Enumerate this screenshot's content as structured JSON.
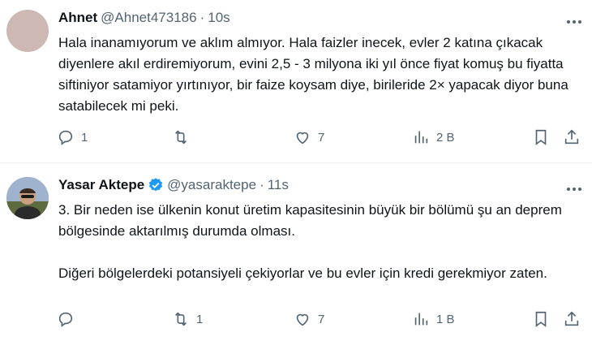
{
  "tweets": [
    {
      "name": "Ahnet",
      "handle": "@Ahnet473186",
      "dot": "·",
      "time": "10s",
      "paragraphs": [
        "Hala inanamıyorum ve aklım almıyor. Hala faizler inecek, evler 2 katına çıkacak diyenlere akıl erdiremiyorum, evini 2,5 - 3 milyona iki yıl önce fiyat komuş bu fiyatta siftiniyor satamiyor yırtınıyor, bir faize koysam diye, birileride 2× yapacak diyor buna satabilecek mi peki."
      ],
      "replies": "1",
      "retweets": "",
      "likes": "7",
      "views": "2 B"
    },
    {
      "name": "Yasar Aktepe",
      "handle": "@yasaraktepe",
      "dot": "·",
      "time": "11s",
      "paragraphs": [
        "3. Bir neden ise ülkenin konut üretim kapasitesinin büyük bir bölümü şu an deprem bölgesinde aktarılmış durumda olması.",
        "Diğeri bölgelerdeki potansiyeli çekiyorlar ve bu evler için kredi gerekmiyor zaten."
      ],
      "replies": "",
      "retweets": "1",
      "likes": "7",
      "views": "1 B"
    }
  ],
  "colors": {
    "text": "#0f1419",
    "muted": "#536471",
    "verified": "#1d9bf0",
    "divider": "#eff3f4"
  },
  "icons": [
    "reply-icon",
    "retweet-icon",
    "like-icon",
    "views-icon",
    "bookmark-icon",
    "share-icon",
    "verified-badge-icon",
    "more-icon"
  ]
}
